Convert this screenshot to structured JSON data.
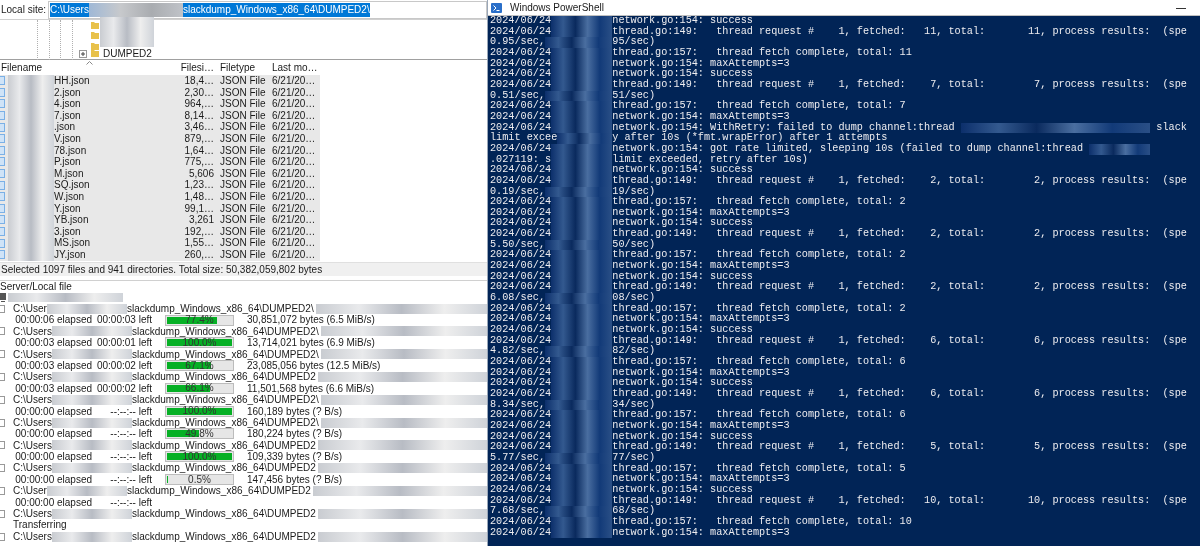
{
  "local_site": {
    "label": "Local site:",
    "path_start": "C:\\Users",
    "path_end": "slackdump_Windows_x86_64\\DUMPED2\\",
    "text_selected": true
  },
  "tree": {
    "items": [
      {
        "label": "DUMPED2",
        "expanded": false
      }
    ]
  },
  "file_list": {
    "columns": [
      "Filename",
      "Filesi…",
      "Filetype",
      "Last mo…"
    ],
    "rows": [
      {
        "name": "HH.json",
        "size": "18,4…",
        "type": "JSON File",
        "modified": "6/21/20…",
        "selected": true
      },
      {
        "name": "2.json",
        "size": "2,30…",
        "type": "JSON File",
        "modified": "6/21/20…",
        "selected": true
      },
      {
        "name": "4.json",
        "size": "964,…",
        "type": "JSON File",
        "modified": "6/21/20…",
        "selected": true
      },
      {
        "name": "7.json",
        "size": "8,14…",
        "type": "JSON File",
        "modified": "6/21/20…",
        "selected": true
      },
      {
        "name": ".json",
        "size": "3,46…",
        "type": "JSON File",
        "modified": "6/21/20…",
        "selected": true
      },
      {
        "name": "V.json",
        "size": "879,…",
        "type": "JSON File",
        "modified": "6/21/20…",
        "selected": true
      },
      {
        "name": "78.json",
        "size": "1,64…",
        "type": "JSON File",
        "modified": "6/21/20…",
        "selected": true
      },
      {
        "name": "P.json",
        "size": "775,…",
        "type": "JSON File",
        "modified": "6/21/20…",
        "selected": true
      },
      {
        "name": "M.json",
        "size": "5,606",
        "type": "JSON File",
        "modified": "6/21/20…",
        "selected": true
      },
      {
        "name": "SQ.json",
        "size": "1,23…",
        "type": "JSON File",
        "modified": "6/21/20…",
        "selected": true
      },
      {
        "name": "W.json",
        "size": "1,48…",
        "type": "JSON File",
        "modified": "6/21/20…",
        "selected": true
      },
      {
        "name": "Y.json",
        "size": "99,1…",
        "type": "JSON File",
        "modified": "6/21/20…",
        "selected": true
      },
      {
        "name": "YB.json",
        "size": "3,261",
        "type": "JSON File",
        "modified": "6/21/20…",
        "selected": true
      },
      {
        "name": "3.json",
        "size": "192,…",
        "type": "JSON File",
        "modified": "6/21/20…",
        "selected": true
      },
      {
        "name": "MS.json",
        "size": "1,55…",
        "type": "JSON File",
        "modified": "6/21/20…",
        "selected": true
      },
      {
        "name": "JY.json",
        "size": "260,…",
        "type": "JSON File",
        "modified": "6/21/20…",
        "selected": true
      }
    ]
  },
  "status_bar": "Selected 1097 files and 941 directories. Total size: 50,382,059,802 bytes",
  "queue": {
    "header": "Server/Local file",
    "items": [
      {
        "kind": "transfer",
        "path_start": "C:\\User",
        "path_end": "slackdump_Windows_x86_64\\DUMPED2\\",
        "elapsed": "00:00:06 elapsed",
        "left": "00:00:03 left",
        "level": 0.774,
        "percent": "77.4%",
        "bytes": "30,851,072 bytes (6.5 MiB/s)"
      },
      {
        "kind": "transfer",
        "path_start": "C:\\Users",
        "path_end": "slackdump_Windows_x86_64\\DUMPED2\\",
        "elapsed": "00:00:03 elapsed",
        "left": "00:00:01 left",
        "level": 1.0,
        "percent": "100.0%",
        "bytes": "13,714,021 bytes (6.9 MiB/s)"
      },
      {
        "kind": "transfer",
        "path_start": "C:\\Users",
        "path_end": "slackdump_Windows_x86_64\\DUMPED2\\",
        "elapsed": "00:00:03 elapsed",
        "left": "00:00:02 left",
        "level": 0.671,
        "percent": "67.1%",
        "bytes": "23,085,056 bytes (12.5 MiB/s)"
      },
      {
        "kind": "transfer",
        "path_start": "C:\\Users",
        "path_end": "slackdump_Windows_x86_64\\DUMPED2",
        "elapsed": "00:00:03 elapsed",
        "left": "00:00:02 left",
        "level": 0.661,
        "percent": "66.1%",
        "bytes": "11,501,568 bytes (6.6 MiB/s)"
      },
      {
        "kind": "transfer",
        "path_start": "C:\\Users",
        "path_end": "slackdump_Windows_x86_64\\DUMPED2\\",
        "elapsed": "00:00:00 elapsed",
        "left": "--:--:-- left",
        "level": 1.0,
        "percent": "100.0%",
        "bytes": "160,189 bytes (? B/s)"
      },
      {
        "kind": "transfer",
        "path_start": "C:\\Users",
        "path_end": "slackdump_Windows_x86_64\\DUMPED2\\",
        "elapsed": "00:00:00 elapsed",
        "left": "--:--:-- left",
        "level": 0.498,
        "percent": "49.8%",
        "bytes": "180,224 bytes (? B/s)"
      },
      {
        "kind": "transfer",
        "path_start": "C:\\Users",
        "path_end": "slackdump_Windows_x86_64\\DUMPED2",
        "elapsed": "00:00:00 elapsed",
        "left": "--:--:-- left",
        "level": 1.0,
        "percent": "100.0%",
        "bytes": "109,339 bytes (? B/s)"
      },
      {
        "kind": "transfer",
        "path_start": "C:\\Users",
        "path_end": "slackdump_Windows_x86_64\\DUMPED2",
        "elapsed": "00:00:00 elapsed",
        "left": "--:--:-- left",
        "level": 0.005,
        "percent": "0.5%",
        "bytes": "147,456 bytes (? B/s)"
      },
      {
        "kind": "waiting",
        "path_start": "C:\\User",
        "path_end": "slackdump_Windows_x86_64\\DUMPED2",
        "elapsed": "00:00:00 elapsed",
        "left": "--:--:-- left"
      },
      {
        "kind": "queued",
        "path_start": "C:\\Users",
        "path_end": "slackdump_Windows_x86_64\\DUMPED2"
      },
      {
        "kind": "status",
        "text": "Transferring"
      },
      {
        "kind": "queued",
        "path_start": "C:\\Users",
        "path_end": "slackdump_Windows_x86_64\\DUMPED2"
      }
    ]
  },
  "terminal": {
    "title": "Windows PowerShell",
    "lines": [
      {
        "kind": "log",
        "left": "2024/06/24",
        "right": "network.go:154: success"
      },
      {
        "kind": "log",
        "left": "2024/06/24",
        "right": "thread.go:149:   thread request #    1, fetched:   11, total:       11, process results:  (spe"
      },
      {
        "kind": "log",
        "left": "0.95/sec,",
        "right": "95/sec)"
      },
      {
        "kind": "log",
        "left": "2024/06/24",
        "right": "thread.go:157:   thread fetch complete, total: 11"
      },
      {
        "kind": "log",
        "left": "2024/06/24",
        "right": "network.go:154: maxAttempts=3"
      },
      {
        "kind": "log",
        "left": "2024/06/24",
        "right": "network.go:154: success"
      },
      {
        "kind": "log",
        "left": "2024/06/24",
        "right": "thread.go:149:   thread request #    1, fetched:    7, total:        7, process results:  (spe"
      },
      {
        "kind": "log",
        "left": "0.51/sec,",
        "right": "51/sec)"
      },
      {
        "kind": "log",
        "left": "2024/06/24",
        "right": "thread.go:157:   thread fetch complete, total: 7"
      },
      {
        "kind": "log",
        "left": "2024/06/24",
        "right": "network.go:154: maxAttempts=3"
      },
      {
        "kind": "masked",
        "left": "2024/06/24",
        "right": "network.go:154: WithRetry: failed to dump channel:thread",
        "tail": "slack"
      },
      {
        "kind": "log",
        "left": "limit excee",
        "right": "y after 10s (*fmt.wrapError) after 1 attempts"
      },
      {
        "kind": "masked",
        "left": "2024/06/24",
        "right": "network.go:154: got rate limited, sleeping 10s (failed to dump channel:thread"
      },
      {
        "kind": "log",
        "left": ".027119: s",
        "right": "limit exceeded, retry after 10s)"
      },
      {
        "kind": "log",
        "left": "2024/06/24",
        "right": "network.go:154: success"
      },
      {
        "kind": "log",
        "left": "2024/06/24",
        "right": "thread.go:149:   thread request #    1, fetched:    2, total:        2, process results:  (spe"
      },
      {
        "kind": "log",
        "left": "0.19/sec,",
        "right": "19/sec)"
      },
      {
        "kind": "log",
        "left": "2024/06/24",
        "right": "thread.go:157:   thread fetch complete, total: 2"
      },
      {
        "kind": "log",
        "left": "2024/06/24",
        "right": "network.go:154: maxAttempts=3"
      },
      {
        "kind": "log",
        "left": "2024/06/24",
        "right": "network.go:154: success"
      },
      {
        "kind": "log",
        "left": "2024/06/24",
        "right": "thread.go:149:   thread request #    1, fetched:    2, total:        2, process results:  (spe"
      },
      {
        "kind": "log",
        "left": "5.50/sec,",
        "right": "50/sec)"
      },
      {
        "kind": "log",
        "left": "2024/06/24",
        "right": "thread.go:157:   thread fetch complete, total: 2"
      },
      {
        "kind": "log",
        "left": "2024/06/24",
        "right": "network.go:154: maxAttempts=3"
      },
      {
        "kind": "log",
        "left": "2024/06/24",
        "right": "network.go:154: success"
      },
      {
        "kind": "log",
        "left": "2024/06/24",
        "right": "thread.go:149:   thread request #    1, fetched:    2, total:        2, process results:  (spe"
      },
      {
        "kind": "log",
        "left": "6.08/sec,",
        "right": "08/sec)"
      },
      {
        "kind": "log",
        "left": "2024/06/24",
        "right": "thread.go:157:   thread fetch complete, total: 2"
      },
      {
        "kind": "log",
        "left": "2024/06/24",
        "right": "network.go:154: maxAttempts=3"
      },
      {
        "kind": "log",
        "left": "2024/06/24",
        "right": "network.go:154: success"
      },
      {
        "kind": "log",
        "left": "2024/06/24",
        "right": "thread.go:149:   thread request #    1, fetched:    6, total:        6, process results:  (spe"
      },
      {
        "kind": "log",
        "left": "4.82/sec,",
        "right": "82/sec)"
      },
      {
        "kind": "log",
        "left": "2024/06/24",
        "right": "thread.go:157:   thread fetch complete, total: 6"
      },
      {
        "kind": "log",
        "left": "2024/06/24",
        "right": "network.go:154: maxAttempts=3"
      },
      {
        "kind": "log",
        "left": "2024/06/24",
        "right": "network.go:154: success"
      },
      {
        "kind": "log",
        "left": "2024/06/24",
        "right": "thread.go:149:   thread request #    1, fetched:    6, total:        6, process results:  (spe"
      },
      {
        "kind": "log",
        "left": "8.34/sec,",
        "right": "34/sec)"
      },
      {
        "kind": "log",
        "left": "2024/06/24",
        "right": "thread.go:157:   thread fetch complete, total: 6"
      },
      {
        "kind": "log",
        "left": "2024/06/24",
        "right": "network.go:154: maxAttempts=3"
      },
      {
        "kind": "log",
        "left": "2024/06/24",
        "right": "network.go:154: success"
      },
      {
        "kind": "log",
        "left": "2024/06/24",
        "right": "thread.go:149:   thread request #    1, fetched:    5, total:        5, process results:  (spe"
      },
      {
        "kind": "log",
        "left": "5.77/sec,",
        "right": "77/sec)"
      },
      {
        "kind": "log",
        "left": "2024/06/24",
        "right": "thread.go:157:   thread fetch complete, total: 5"
      },
      {
        "kind": "log",
        "left": "2024/06/24",
        "right": "network.go:154: maxAttempts=3"
      },
      {
        "kind": "log",
        "left": "2024/06/24",
        "right": "network.go:154: success"
      },
      {
        "kind": "log",
        "left": "2024/06/24",
        "right": "thread.go:149:   thread request #    1, fetched:   10, total:       10, process results:  (spe"
      },
      {
        "kind": "log",
        "left": "7.68/sec,",
        "right": "68/sec)"
      },
      {
        "kind": "log",
        "left": "2024/06/24",
        "right": "thread.go:157:   thread fetch complete, total: 10"
      },
      {
        "kind": "log",
        "left": "2024/06/24",
        "right": "network.go:154: maxAttempts=3"
      }
    ]
  }
}
